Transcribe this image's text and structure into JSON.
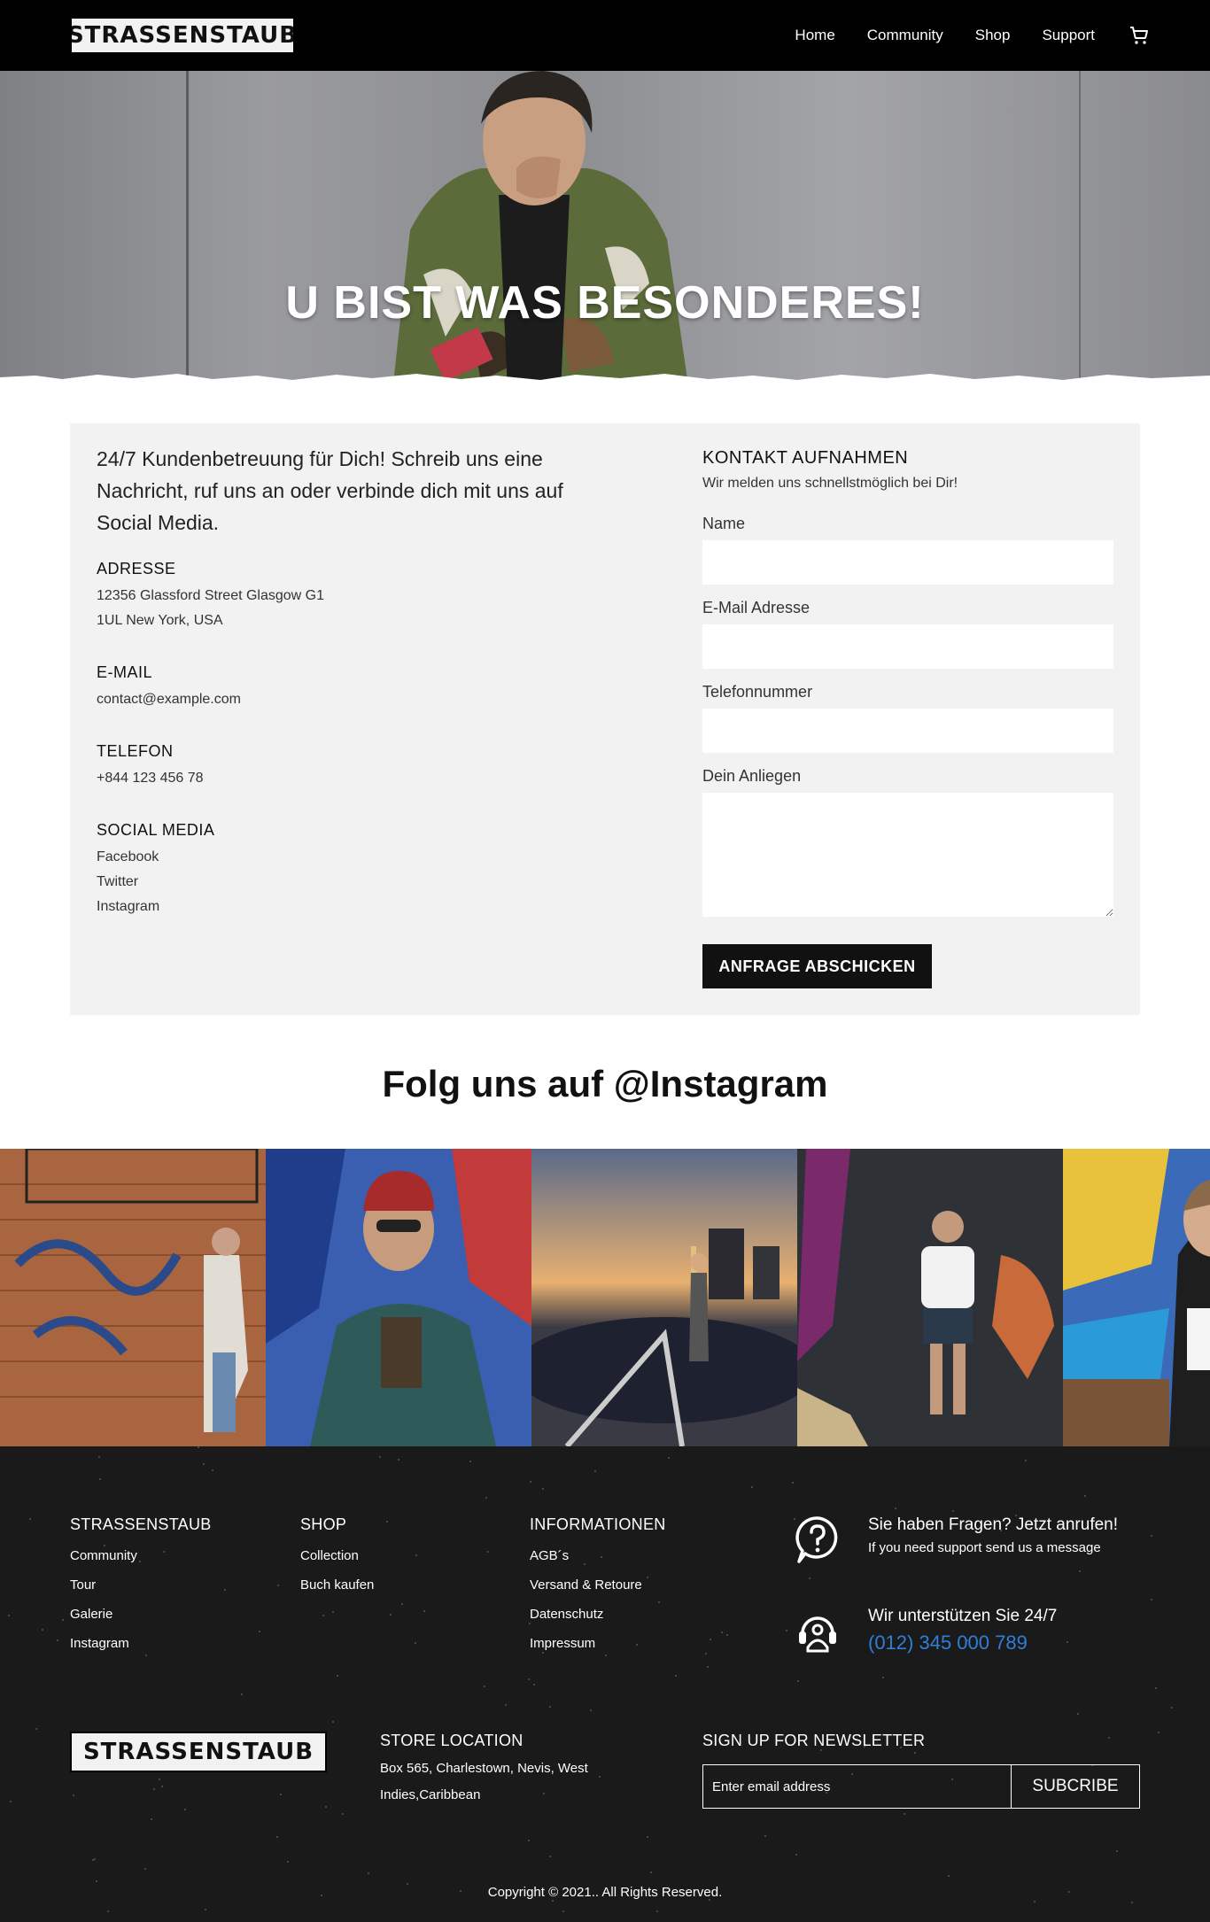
{
  "header": {
    "logo_text": "STRASSENSTAUB",
    "nav": [
      "Home",
      "Community",
      "Shop",
      "Support"
    ]
  },
  "hero": {
    "title": "U BIST WAS BESONDERES!"
  },
  "contact": {
    "intro": "24/7 Kundenbetreuung für Dich! Schreib uns eine Nachricht, ruf uns an oder verbinde dich mit uns auf Social Media.",
    "address": {
      "heading": "ADRESSE",
      "lines": [
        "12356 Glassford Street Glasgow G1",
        "1UL New York, USA"
      ]
    },
    "email": {
      "heading": "E-MAIL",
      "value": "contact@example.com"
    },
    "phone": {
      "heading": "TELEFON",
      "value": "+844 123 456 78"
    },
    "social": {
      "heading": "SOCIAL MEDIA",
      "links": [
        "Facebook",
        "Twitter",
        "Instagram"
      ]
    },
    "form": {
      "title": "KONTAKT AUFNAHMEN",
      "subtitle": "Wir melden uns schnellstmöglich bei Dir!",
      "name_label": "Name",
      "email_label": "E-Mail Adresse",
      "phone_label": "Telefonnummer",
      "message_label": "Dein Anliegen",
      "submit_label": "ANFRAGE ABSCHICKEN"
    }
  },
  "instagram": {
    "title": "Folg uns auf @Instagram"
  },
  "footer": {
    "col1": {
      "heading": "STRASSENSTAUB",
      "links": [
        "Community",
        "Tour",
        "Galerie",
        "Instagram"
      ]
    },
    "col2": {
      "heading": "SHOP",
      "links": [
        "Collection",
        "Buch kaufen"
      ]
    },
    "col3": {
      "heading": "INFORMATIONEN",
      "links": [
        "AGB´s",
        "Versand & Retoure",
        "Datenschutz",
        "Impressum"
      ]
    },
    "help": {
      "title": "Sie haben Fragen? Jetzt anrufen!",
      "subtitle": "If you need support send us a message"
    },
    "support": {
      "title": "Wir unterstützen Sie 24/7",
      "phone": "(012) 345 000 789"
    },
    "logo_text": "STRASSENSTAUB",
    "store": {
      "heading": "STORE LOCATION",
      "address": "Box 565, Charlestown, Nevis, West Indies,Caribbean"
    },
    "newsletter": {
      "heading": "SIGN UP FOR NEWSLETTER",
      "placeholder": "Enter email address",
      "button": "SUBCRIBE"
    },
    "copyright": "Copyright © 2021.. All Rights Reserved."
  },
  "colors": {
    "header_bg": "#000000",
    "footer_bg": "#1a1a1a",
    "contact_box_bg": "#f2f2f2",
    "phone_link": "#2f7fd8",
    "button_bg": "#111111"
  }
}
